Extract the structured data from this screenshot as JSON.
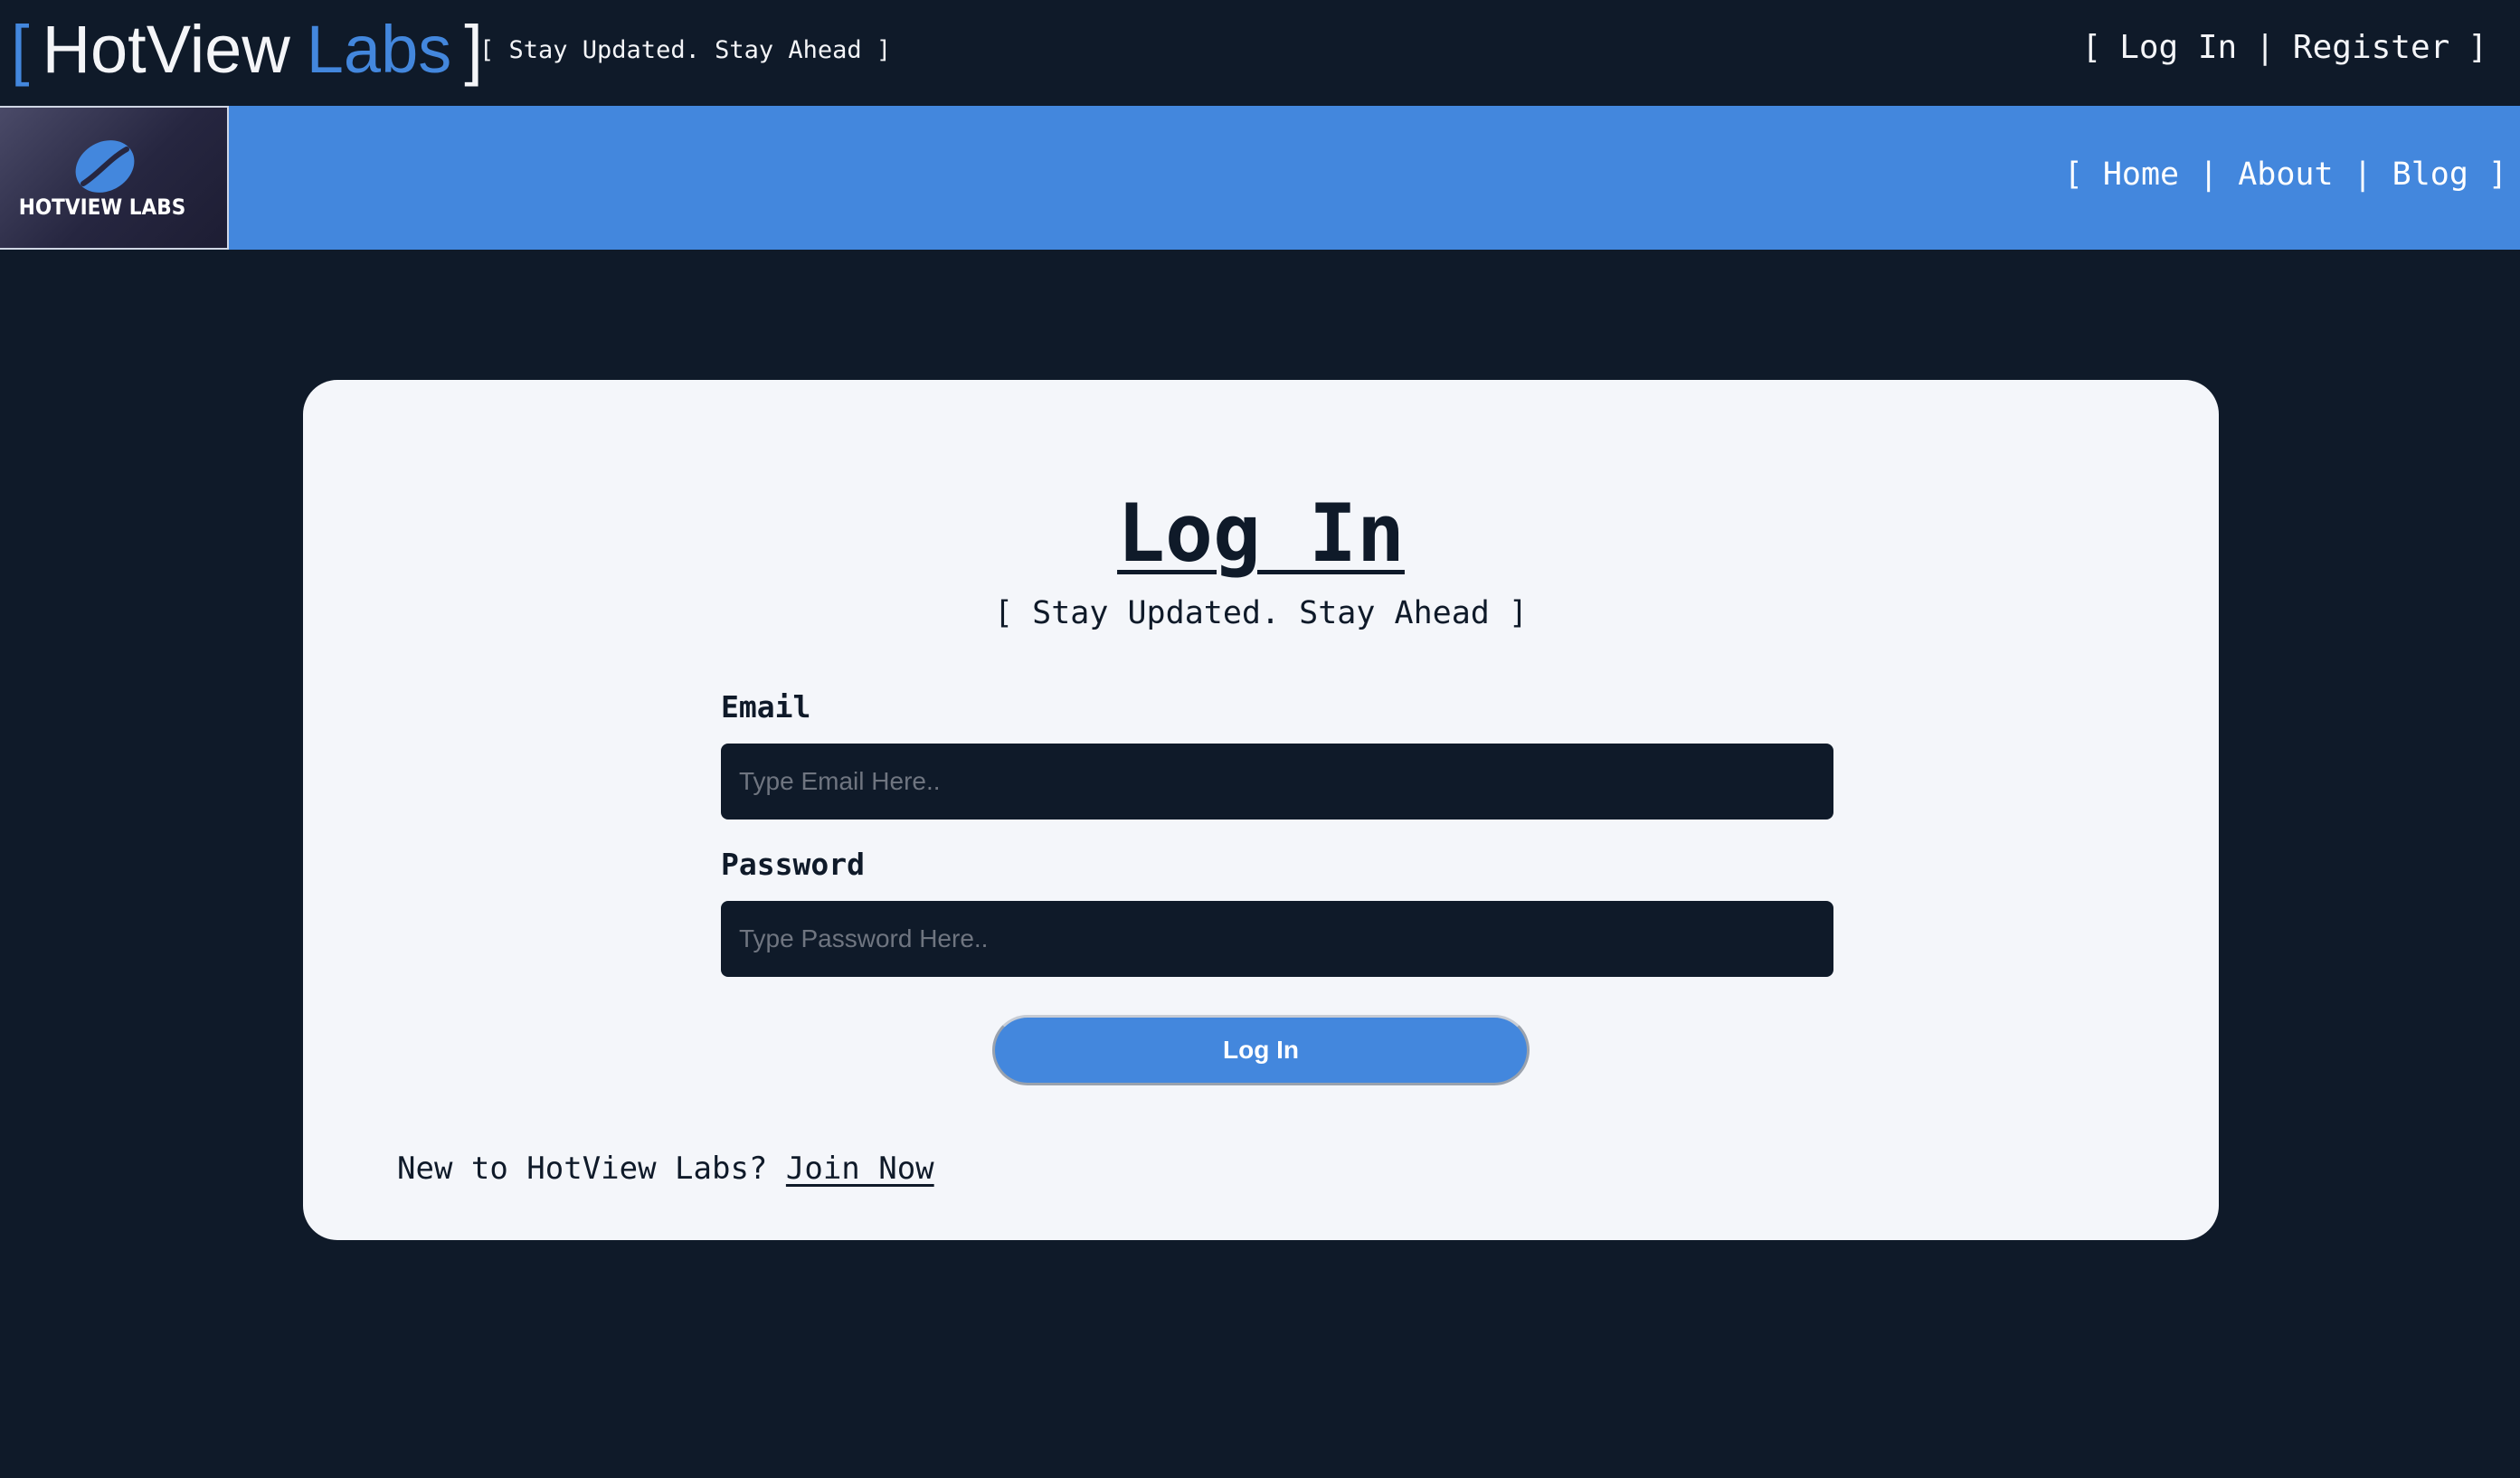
{
  "header": {
    "brand_open_bracket": "[",
    "brand_name_first": "HotView",
    "brand_name_second": "Labs",
    "brand_close_bracket": "]",
    "tagline": "[ Stay Updated. Stay Ahead ]",
    "auth_nav": {
      "open_bracket": "[",
      "login": "Log In",
      "separator": "|",
      "register": "Register",
      "close_bracket": "]"
    }
  },
  "navbar": {
    "logo_text": "HOTVIEW LABS",
    "open_bracket": "[",
    "home": "Home",
    "separator": "|",
    "about": "About",
    "blog": "Blog",
    "close_bracket": "]"
  },
  "login_form": {
    "title": "Log In",
    "subtitle": "[ Stay Updated. Stay Ahead ]",
    "email_label": "Email",
    "email_placeholder": "Type Email Here..",
    "email_value": "",
    "password_label": "Password",
    "password_placeholder": "Type Password Here..",
    "password_value": "",
    "submit_label": "Log In",
    "signup_prompt": "New to HotView Labs?",
    "signup_link": "Join Now"
  },
  "colors": {
    "page_background": "#0f1a29",
    "accent": "#4387dd",
    "card_background": "#f4f6fa",
    "text_light": "#f4f5f8",
    "text_dark": "#0f1a29"
  },
  "icons": {
    "logo": "coffee-bean-icon"
  }
}
